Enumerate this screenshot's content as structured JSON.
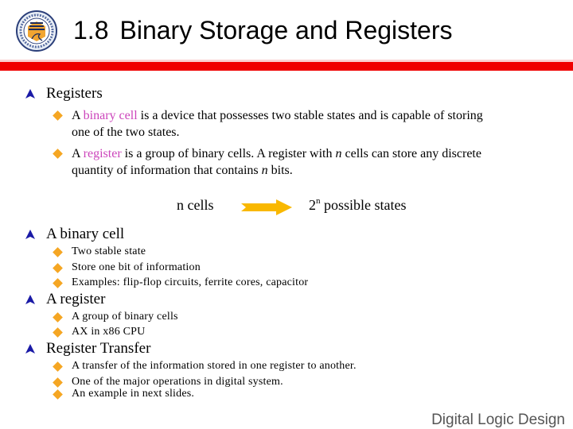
{
  "slide": {
    "title_number": "1.8",
    "title_text": "Binary Storage and Registers",
    "footer": "Digital Logic Design",
    "colors": {
      "title_bar": "#f00000",
      "highlight": "#cc44bb",
      "bullet_diamond": "#f5a623",
      "bullet_triangle": "#1a1aa6",
      "arrow": "#f9b800"
    }
  },
  "section_registers": {
    "heading": "Registers",
    "bullets": [
      {
        "pre": "A ",
        "highlight": "binary cell",
        "post": " is a device that possesses two stable states and is capable of storing",
        "line2": "one of the two states."
      },
      {
        "pre": "A ",
        "highlight": "register",
        "post_a": " is a group of binary cells. A register with ",
        "italic": "n",
        "post_b": " cells can store any discrete",
        "line2_a": "quantity of information that contains ",
        "line2_italic": "n",
        "line2_b": " bits."
      }
    ]
  },
  "diagram": {
    "left_label": "n cells",
    "right_base": "2",
    "right_exponent": "n",
    "right_label": " possible states"
  },
  "section_binary_cell": {
    "heading": "A binary cell",
    "bullets": [
      "Two stable state",
      "Store one bit of information",
      "Examples: flip-flop circuits, ferrite cores, capacitor"
    ]
  },
  "section_register": {
    "heading": "A register",
    "bullets": [
      "A group of binary cells",
      "AX in x86 CPU"
    ]
  },
  "section_transfer": {
    "heading": "Register Transfer",
    "bullets": [
      "A transfer of the information stored in one register to another.",
      "One of the major operations in digital system.",
      "An example in next slides."
    ]
  }
}
